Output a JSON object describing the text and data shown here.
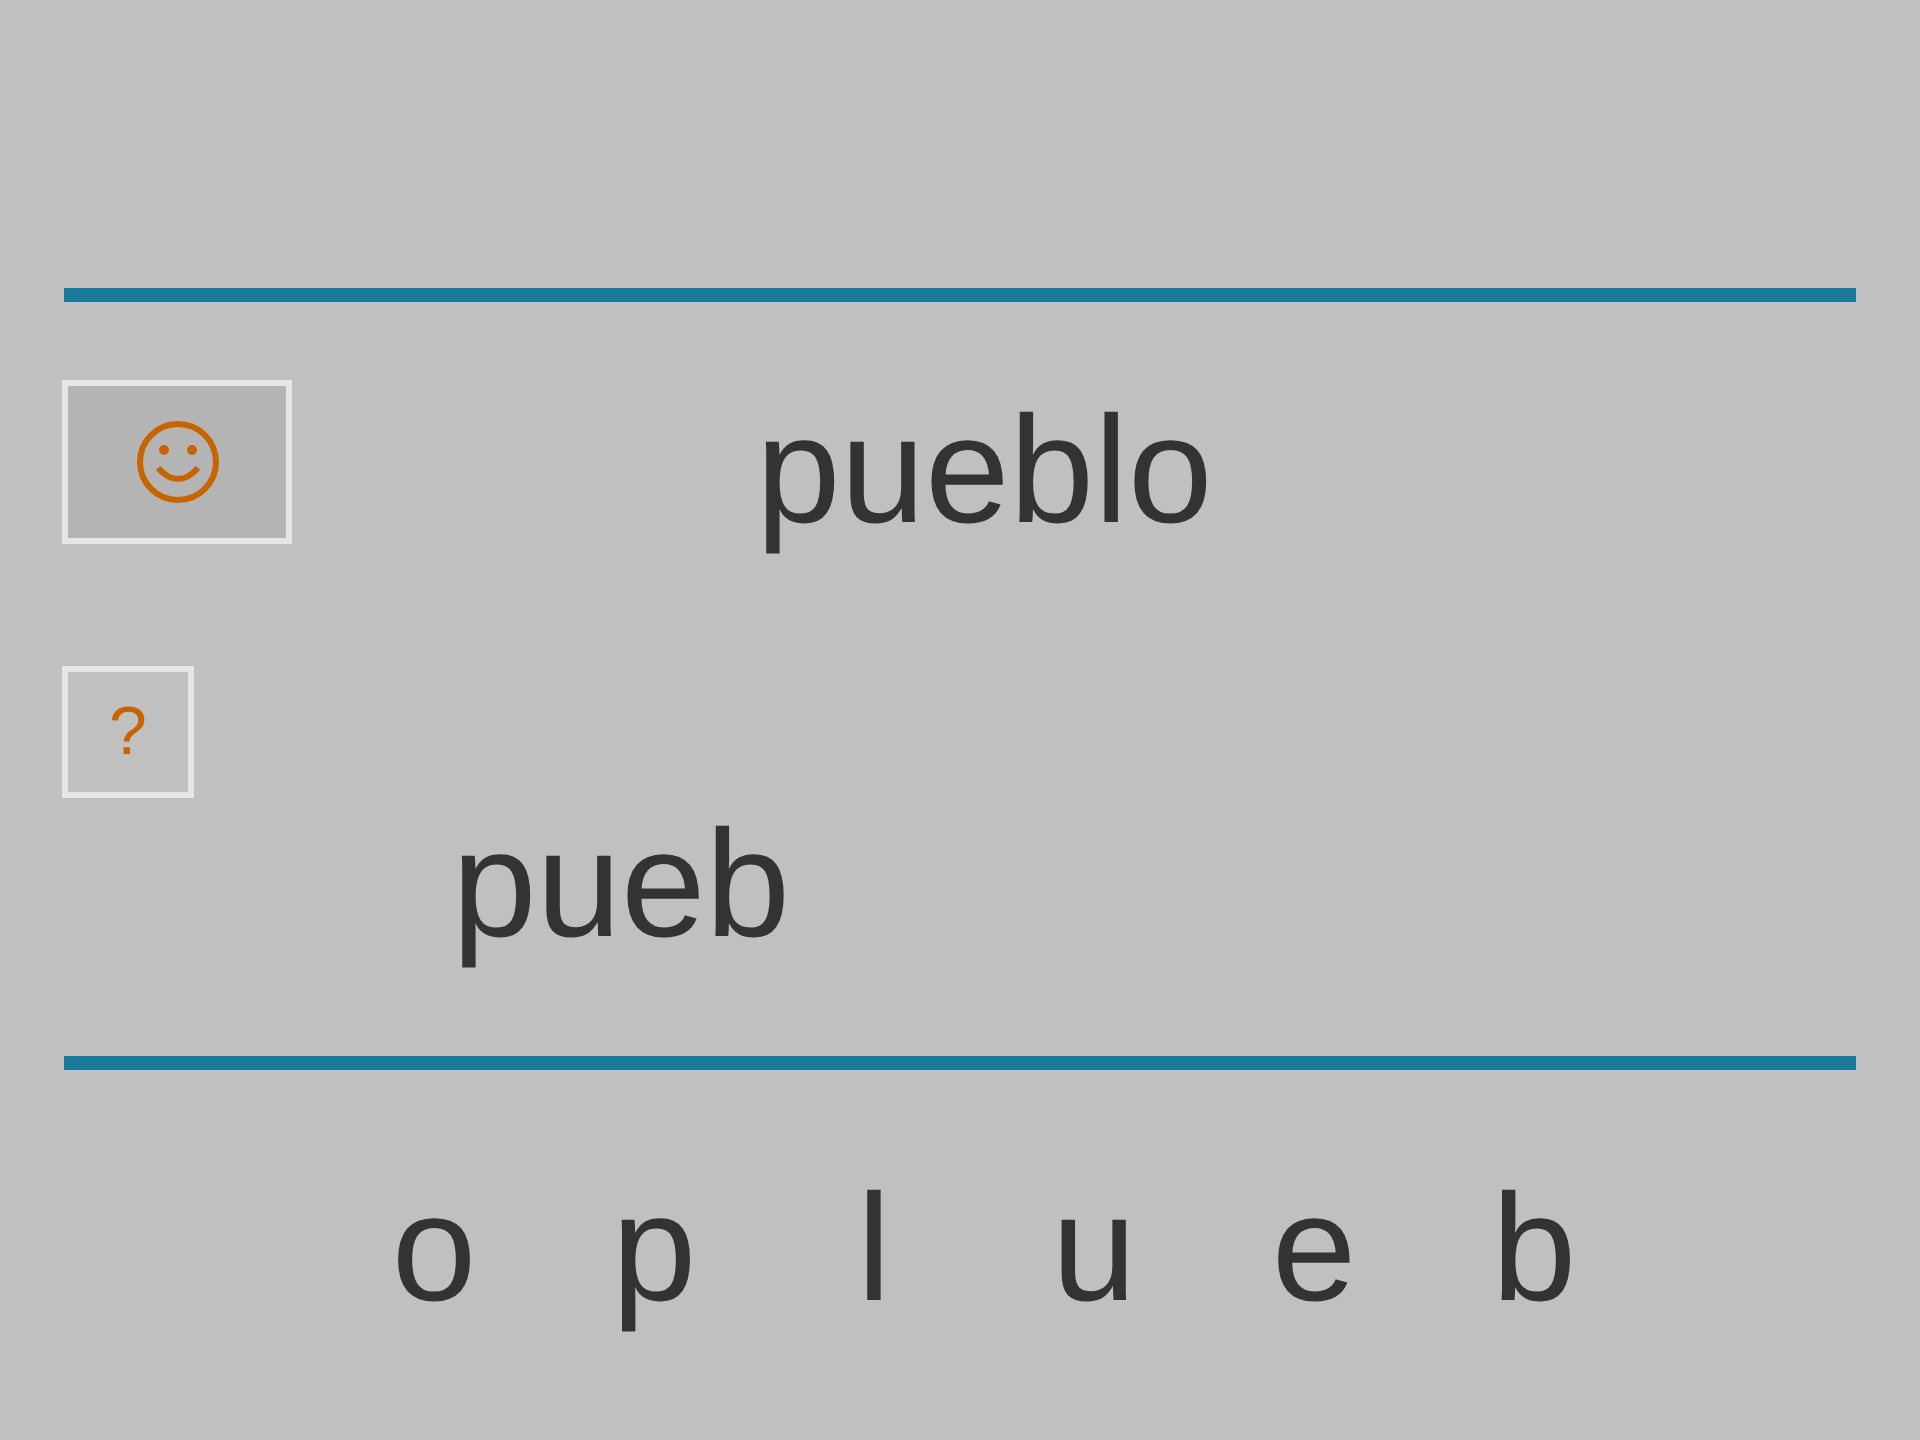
{
  "target_word": "pueblo",
  "help_button": {
    "label": "?"
  },
  "answer": {
    "value": "pueb"
  },
  "letters": [
    "o",
    "p",
    "l",
    "u",
    "e",
    "b"
  ]
}
